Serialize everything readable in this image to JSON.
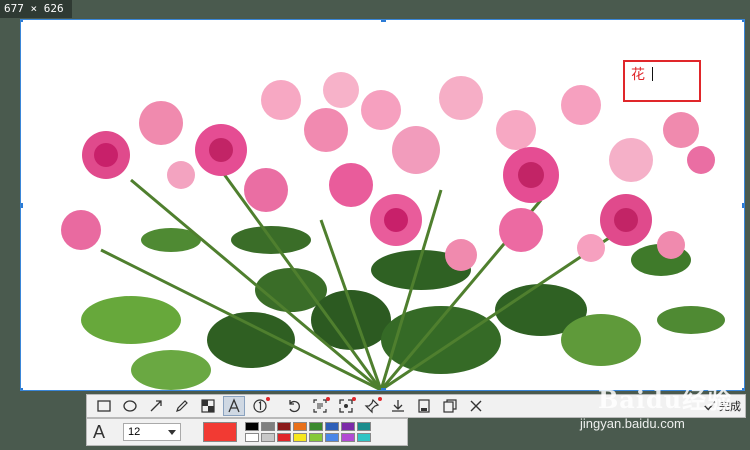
{
  "capture": {
    "dimensions_label": "677 × 626",
    "image_subject": "pink roses bouquet"
  },
  "annotation": {
    "text": "花",
    "color": "#e0262a"
  },
  "toolbar": {
    "tools": [
      {
        "name": "rectangle-tool",
        "icon": "rectangle-icon"
      },
      {
        "name": "ellipse-tool",
        "icon": "ellipse-icon"
      },
      {
        "name": "arrow-tool",
        "icon": "arrow-icon"
      },
      {
        "name": "pencil-tool",
        "icon": "pencil-icon"
      },
      {
        "name": "mosaic-tool",
        "icon": "mosaic-icon"
      },
      {
        "name": "text-tool",
        "icon": "text-icon",
        "active": true
      },
      {
        "name": "number-tool",
        "icon": "number-icon"
      },
      {
        "name": "undo-tool",
        "icon": "undo-icon"
      },
      {
        "name": "ocr-tool",
        "icon": "ocr-icon"
      },
      {
        "name": "fullscreen-tool",
        "icon": "expand-icon"
      },
      {
        "name": "pin-tool",
        "icon": "pin-icon"
      },
      {
        "name": "download-tool",
        "icon": "download-icon"
      },
      {
        "name": "save-tool",
        "icon": "save-icon"
      },
      {
        "name": "copy-tool",
        "icon": "copy-icon"
      },
      {
        "name": "cancel-tool",
        "icon": "close-icon"
      }
    ],
    "done_label": "完成"
  },
  "style_panel": {
    "font_icon_glyph": "A",
    "font_size": "12",
    "current_color": "#f23a33",
    "palette": [
      "#000000",
      "#7f7f7f",
      "#8b1a1a",
      "#e8701a",
      "#3b8a2e",
      "#2e5fb8",
      "#7b2aa8",
      "#1a8c8c",
      "#ffffff",
      "#c8c8c8",
      "#e0262a",
      "#f5e61f",
      "#86c83a",
      "#4a86e8",
      "#b24ad4",
      "#31c4c4"
    ]
  },
  "watermark": {
    "logo": "Baidu经验",
    "url": "jingyan.baidu.com"
  }
}
